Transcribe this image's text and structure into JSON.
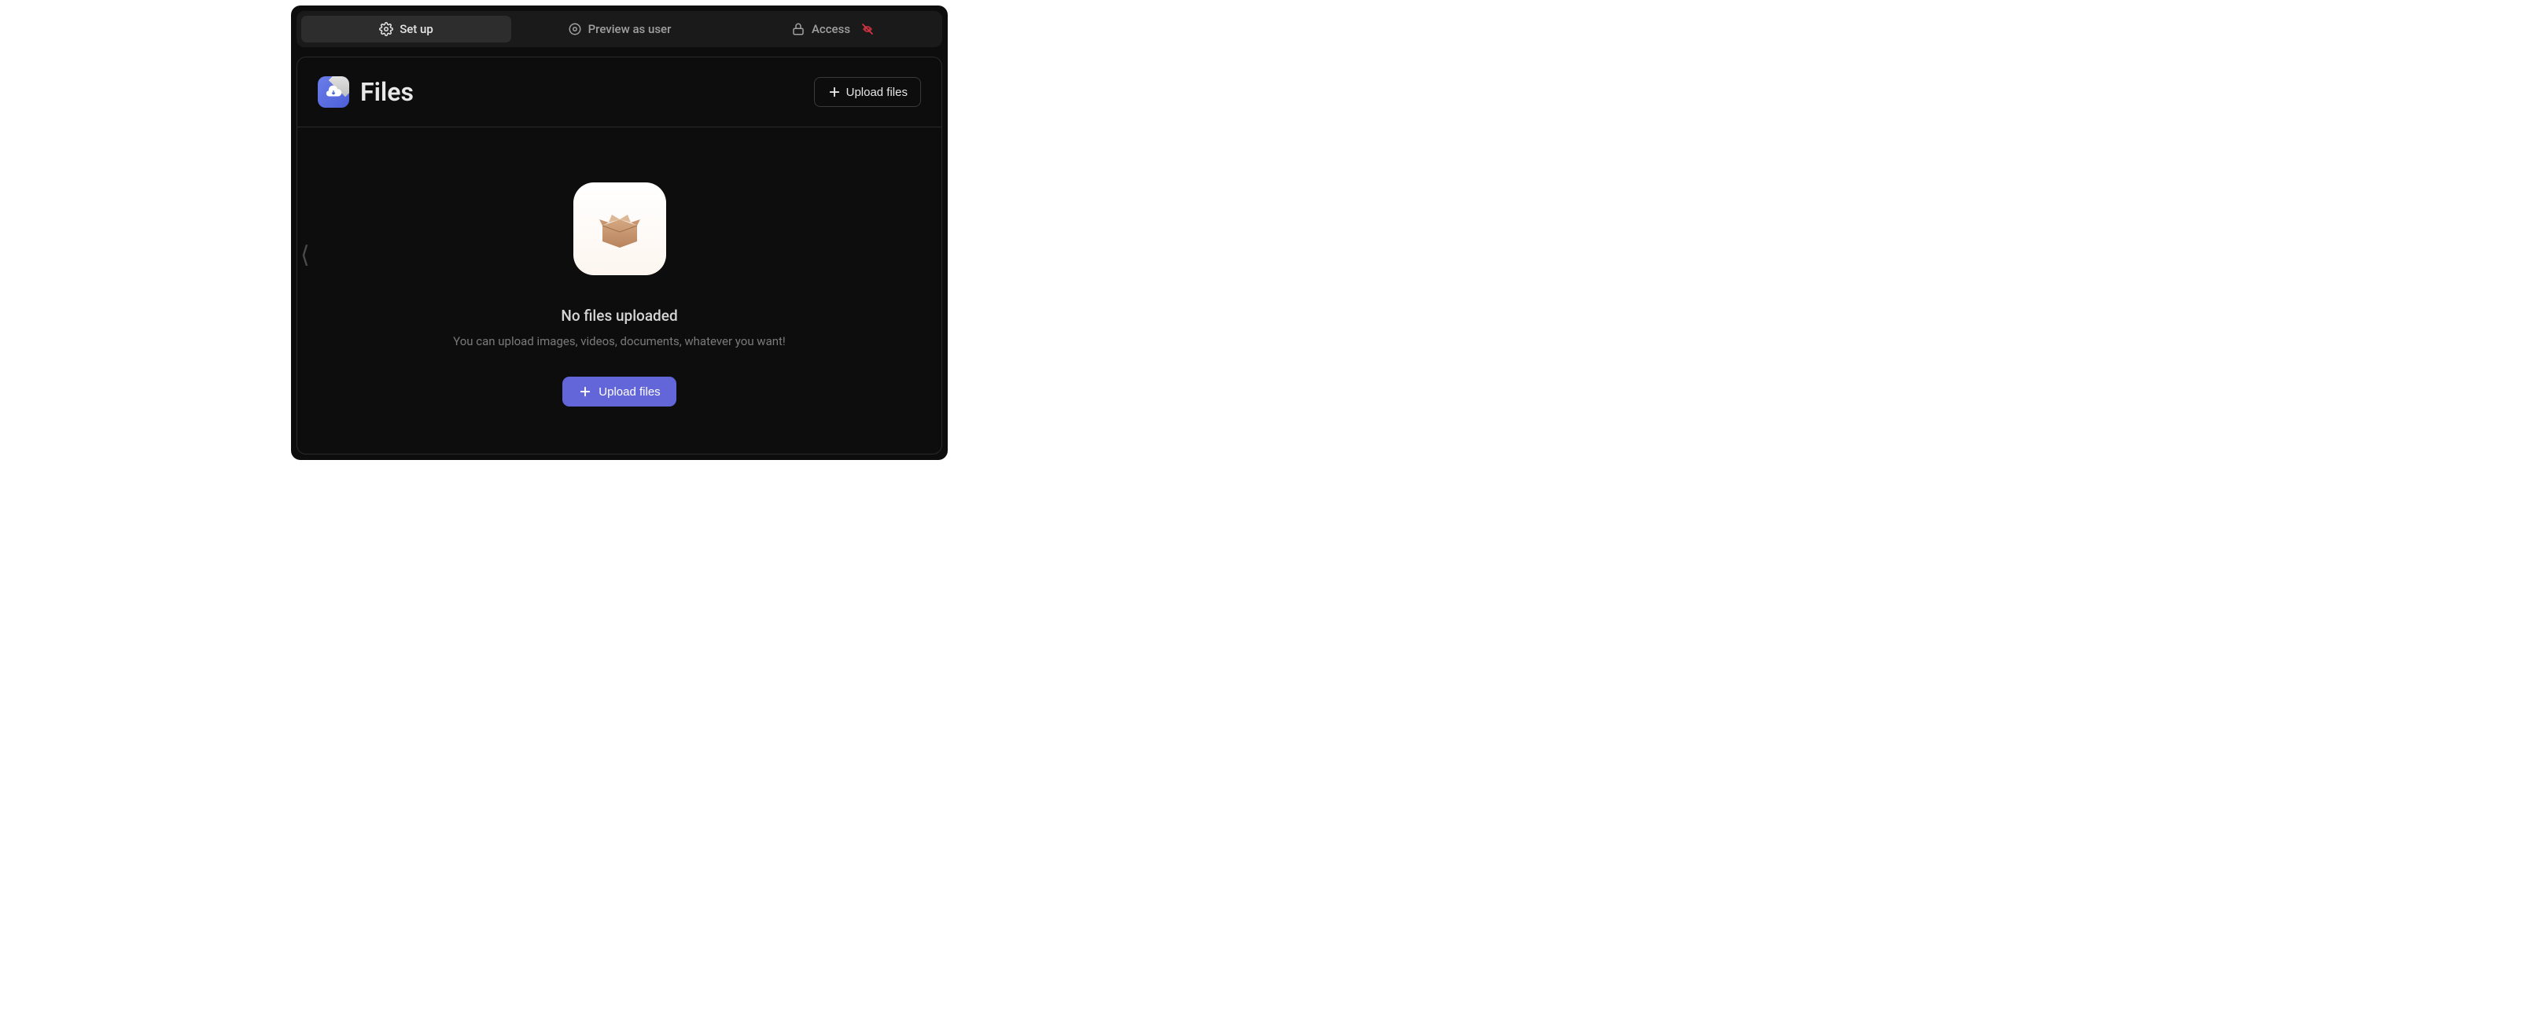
{
  "tabs": {
    "setup": "Set up",
    "preview": "Preview as user",
    "access": "Access"
  },
  "panel": {
    "title": "Files",
    "upload_button": "Upload files"
  },
  "empty_state": {
    "title": "No files uploaded",
    "subtitle": "You can upload images, videos, documents, whatever you want!",
    "upload_button": "Upload files"
  }
}
